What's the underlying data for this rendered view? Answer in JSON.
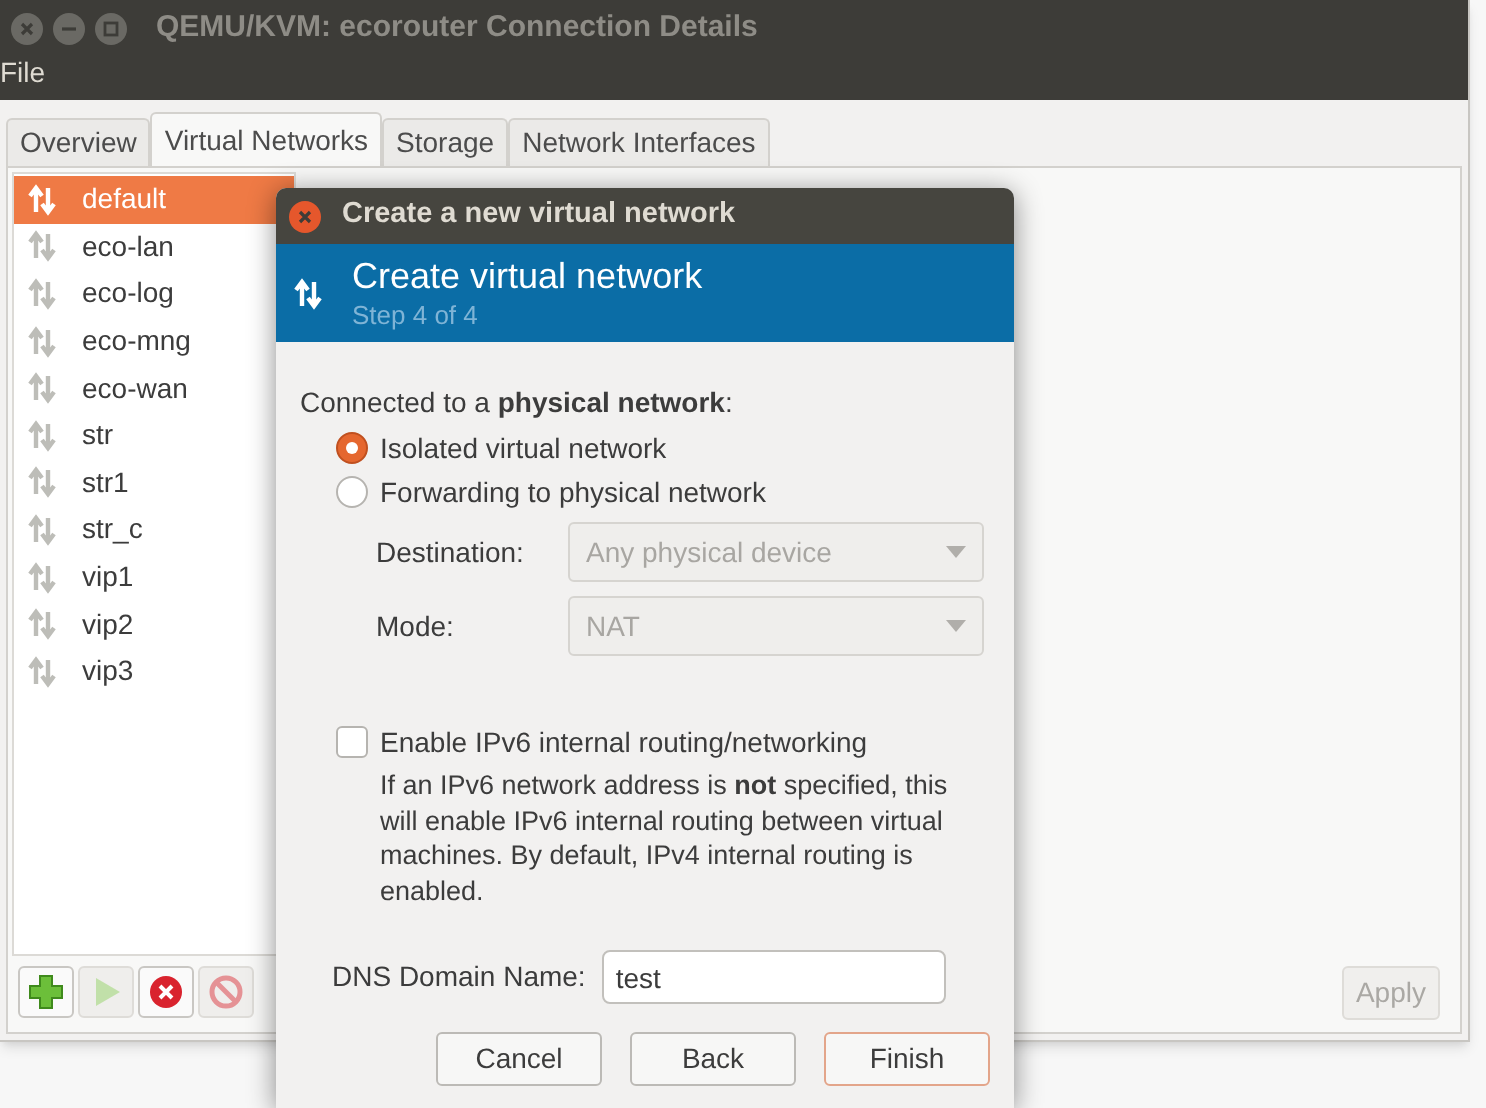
{
  "window": {
    "title": "QEMU/KVM: ecorouter Connection Details"
  },
  "menu": [
    "File"
  ],
  "tabs": [
    {
      "label": "Overview",
      "selected": false
    },
    {
      "label": "Virtual Networks",
      "selected": true
    },
    {
      "label": "Storage",
      "selected": false
    },
    {
      "label": "Network Interfaces",
      "selected": false
    }
  ],
  "networks": [
    {
      "name": "default",
      "selected": true
    },
    {
      "name": "eco-lan",
      "selected": false
    },
    {
      "name": "eco-log",
      "selected": false
    },
    {
      "name": "eco-mng",
      "selected": false
    },
    {
      "name": "eco-wan",
      "selected": false
    },
    {
      "name": "str",
      "selected": false
    },
    {
      "name": "str1",
      "selected": false
    },
    {
      "name": "str_c",
      "selected": false
    },
    {
      "name": "vip1",
      "selected": false
    },
    {
      "name": "vip2",
      "selected": false
    },
    {
      "name": "vip3",
      "selected": false
    }
  ],
  "toolbar": [
    {
      "kind": "add",
      "disabled": false
    },
    {
      "kind": "start",
      "disabled": true
    },
    {
      "kind": "delete",
      "disabled": false
    },
    {
      "kind": "stop",
      "disabled": true
    }
  ],
  "apply_button": {
    "label": "Apply",
    "disabled": true
  },
  "dialog": {
    "title": "Create a new virtual network",
    "header_title": "Create virtual network",
    "header_step": "Step 4 of 4",
    "section_label": "Connected to a **physical network**:",
    "options": [
      {
        "label": "Isolated virtual network",
        "selected": true
      },
      {
        "label": "Forwarding to physical network",
        "selected": false
      }
    ],
    "destination": {
      "label": "Destination:",
      "value": "Any physical device",
      "disabled": true
    },
    "mode": {
      "label": "Mode:",
      "value": "NAT",
      "disabled": true
    },
    "ipv6": {
      "label": "Enable IPv6 internal routing/networking",
      "checked": false
    },
    "ipv6_note": "If an IPv6 network address is **not** specified, this will enable IPv6 internal routing between virtual machines.  By default, IPv4 internal routing is enabled.",
    "dns": {
      "label": "DNS Domain Name:",
      "value": "test"
    },
    "buttons": [
      {
        "label": "Cancel",
        "kind": "normal"
      },
      {
        "label": "Back",
        "kind": "normal"
      },
      {
        "label": "Finish",
        "kind": "default"
      }
    ]
  }
}
